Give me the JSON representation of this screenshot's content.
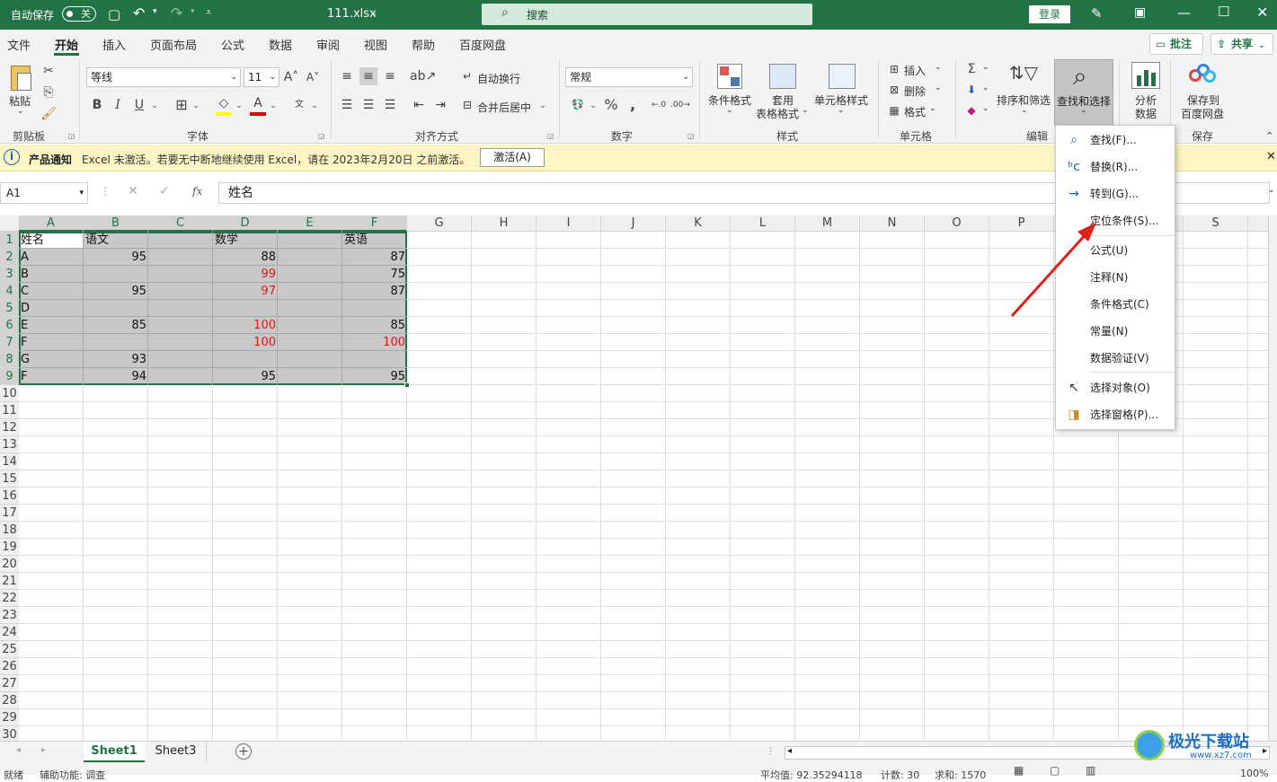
{
  "titlebar": {
    "autosave_label": "自动保存",
    "autosave_state": "关",
    "filename": "111.xlsx",
    "search_placeholder": "搜索",
    "login": "登录"
  },
  "menu_tabs": [
    "文件",
    "开始",
    "插入",
    "页面布局",
    "公式",
    "数据",
    "审阅",
    "视图",
    "帮助",
    "百度网盘"
  ],
  "active_tab": "开始",
  "header_buttons": {
    "comments": "批注",
    "share": "共享"
  },
  "ribbon": {
    "clipboard": {
      "paste": "粘贴",
      "group": "剪贴板"
    },
    "font": {
      "name": "等线",
      "size": "11",
      "group": "字体",
      "bold": "B",
      "italic": "I",
      "underline": "U"
    },
    "alignment": {
      "wrap": "自动换行",
      "merge": "合并后居中",
      "group": "对齐方式"
    },
    "number": {
      "format": "常规",
      "group": "数字"
    },
    "styles": {
      "conditional": "条件格式",
      "table_l1": "套用",
      "table_l2": "表格格式",
      "cell_styles": "单元格样式",
      "group": "样式"
    },
    "cells": {
      "insert": "插入",
      "delete": "删除",
      "format": "格式",
      "group": "单元格"
    },
    "editing": {
      "sort": "排序和筛选",
      "find": "查找和选择",
      "group": "编辑"
    },
    "analysis": {
      "l1": "分析",
      "l2": "数据"
    },
    "save": {
      "l1": "保存到",
      "l2": "百度网盘",
      "group": "保存"
    }
  },
  "notify": {
    "title": "产品通知",
    "message": "Excel 未激活。若要无中断地继续使用 Excel，请在 2023年2月20日 之前激活。",
    "button": "激活(A)"
  },
  "formula_bar": {
    "name_box": "A1",
    "fx": "fx",
    "content": "姓名"
  },
  "columns": [
    "A",
    "B",
    "C",
    "D",
    "E",
    "F",
    "G",
    "H",
    "I",
    "J",
    "K",
    "L",
    "M",
    "N",
    "O",
    "P",
    "Q",
    "R",
    "S"
  ],
  "rows": [
    "1",
    "2",
    "3",
    "4",
    "5",
    "6",
    "7",
    "8",
    "9",
    "10",
    "11",
    "12",
    "13",
    "14",
    "15",
    "16",
    "17",
    "18",
    "19",
    "20",
    "21",
    "22",
    "23",
    "24",
    "25",
    "26",
    "27",
    "28",
    "29",
    "30"
  ],
  "cells": [
    [
      "姓名",
      "语文",
      "",
      "数学",
      "",
      "英语"
    ],
    [
      "A",
      "95",
      "",
      "88",
      "",
      "87"
    ],
    [
      "B",
      "",
      "",
      "99",
      "",
      "75"
    ],
    [
      "C",
      "95",
      "",
      "97",
      "",
      "87"
    ],
    [
      "D",
      "",
      "",
      "",
      "",
      ""
    ],
    [
      "E",
      "85",
      "",
      "100",
      "",
      "85"
    ],
    [
      "F",
      "",
      "",
      "100",
      "",
      "100"
    ],
    [
      "G",
      "93",
      "",
      "",
      "",
      ""
    ],
    [
      "F",
      "94",
      "",
      "95",
      "",
      "95"
    ]
  ],
  "red_cells": [
    "D3",
    "D4",
    "D6",
    "D7",
    "F7"
  ],
  "dropdown": {
    "items": [
      {
        "label": "查找(F)...",
        "icon": "search-icon"
      },
      {
        "label": "替换(R)...",
        "icon": "replace-icon"
      },
      {
        "label": "转到(G)...",
        "icon": "arrow-right-icon"
      },
      {
        "label": "定位条件(S)...",
        "icon": ""
      },
      {
        "label": "公式(U)",
        "icon": ""
      },
      {
        "label": "注释(N)",
        "icon": ""
      },
      {
        "label": "条件格式(C)",
        "icon": ""
      },
      {
        "label": "常量(N)",
        "icon": ""
      },
      {
        "label": "数据验证(V)",
        "icon": ""
      },
      {
        "label": "选择对象(O)",
        "icon": "cursor-icon"
      },
      {
        "label": "选择窗格(P)...",
        "icon": "selection-pane-icon"
      }
    ]
  },
  "sheets": [
    "Sheet1",
    "Sheet3"
  ],
  "active_sheet": "Sheet1",
  "status": {
    "ready": "就绪",
    "accessibility": "辅助功能: 调查",
    "average": "平均值: 92.35294118",
    "count": "计数: 30",
    "sum": "求和: 1570",
    "zoom": "100%"
  },
  "watermark": {
    "name": "极光下载站",
    "url": "www.xz7.com"
  },
  "colors": {
    "excel_green": "#217346",
    "red_text": "#d51a1a",
    "selection_fill": "#c8c8c8",
    "notify_bg": "#fdf6c4"
  }
}
